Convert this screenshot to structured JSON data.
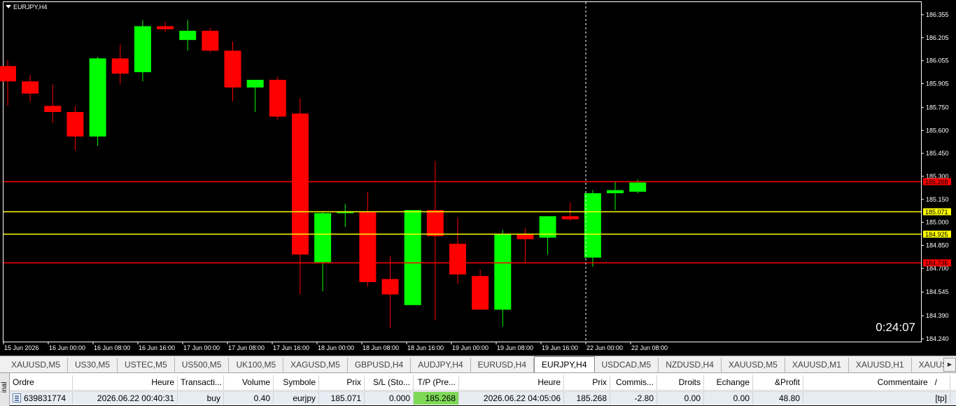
{
  "chart": {
    "title": "EURJPY,H4",
    "timer": "0:24:07",
    "price_labels": [
      "186.355",
      "186.205",
      "186.055",
      "185.905",
      "185.750",
      "185.600",
      "185.450",
      "185.300",
      "185.150",
      "185.000",
      "184.850",
      "184.700",
      "184.545",
      "184.390",
      "184.240"
    ],
    "time_labels": [
      "15 Jun 2026",
      "16 Jun 00:00",
      "16 Jun 08:00",
      "16 Jun 16:00",
      "17 Jun 00:00",
      "17 Jun 08:00",
      "17 Jun 16:00",
      "18 Jun 00:00",
      "18 Jun 08:00",
      "18 Jun 16:00",
      "19 Jun 00:00",
      "19 Jun 08:00",
      "19 Jun 16:00",
      "22 Jun 00:00",
      "22 Jun 08:00"
    ],
    "lines": [
      {
        "price": 185.268,
        "label": "185.268",
        "color": "#ff0000",
        "label_bg": "#ff0000"
      },
      {
        "price": 185.071,
        "label": "185.071",
        "color": "#ffff00",
        "label_bg": "#ffff00"
      },
      {
        "price": 184.925,
        "label": "184.925",
        "color": "#ffff00",
        "label_bg": "#ffff00"
      },
      {
        "price": 184.736,
        "label": "184.736",
        "color": "#ff0000",
        "label_bg": "#ff0000"
      }
    ],
    "colors": {
      "bull": "#00ff00",
      "bear": "#ff0000",
      "background": "#000000",
      "axis": "#ffffff"
    }
  },
  "chart_data": {
    "type": "candlestick",
    "symbol": "EURJPY",
    "timeframe": "H4",
    "ylim": [
      184.24,
      186.42
    ],
    "candles": [
      {
        "o": 186.02,
        "h": 186.06,
        "l": 185.76,
        "c": 185.92
      },
      {
        "o": 185.92,
        "h": 185.96,
        "l": 185.79,
        "c": 185.84
      },
      {
        "o": 185.76,
        "h": 185.9,
        "l": 185.65,
        "c": 185.72
      },
      {
        "o": 185.72,
        "h": 185.76,
        "l": 185.47,
        "c": 185.56
      },
      {
        "o": 185.56,
        "h": 186.08,
        "l": 185.5,
        "c": 186.07
      },
      {
        "o": 186.07,
        "h": 186.16,
        "l": 185.9,
        "c": 185.97
      },
      {
        "o": 185.98,
        "h": 186.32,
        "l": 185.92,
        "c": 186.28
      },
      {
        "o": 186.28,
        "h": 186.31,
        "l": 186.24,
        "c": 186.26
      },
      {
        "o": 186.19,
        "h": 186.32,
        "l": 186.12,
        "c": 186.25
      },
      {
        "o": 186.25,
        "h": 186.27,
        "l": 186.11,
        "c": 186.12
      },
      {
        "o": 186.12,
        "h": 186.18,
        "l": 185.79,
        "c": 185.88
      },
      {
        "o": 185.88,
        "h": 185.93,
        "l": 185.72,
        "c": 185.93
      },
      {
        "o": 185.93,
        "h": 185.95,
        "l": 185.67,
        "c": 185.69
      },
      {
        "o": 185.71,
        "h": 185.81,
        "l": 184.53,
        "c": 184.79
      },
      {
        "o": 184.74,
        "h": 185.07,
        "l": 184.55,
        "c": 185.06
      },
      {
        "o": 185.06,
        "h": 185.12,
        "l": 184.97,
        "c": 185.07
      },
      {
        "o": 185.07,
        "h": 185.2,
        "l": 184.58,
        "c": 184.61
      },
      {
        "o": 184.63,
        "h": 184.78,
        "l": 184.31,
        "c": 184.53
      },
      {
        "o": 184.46,
        "h": 185.08,
        "l": 184.46,
        "c": 185.08
      },
      {
        "o": 185.08,
        "h": 185.4,
        "l": 184.36,
        "c": 184.91
      },
      {
        "o": 184.86,
        "h": 185.03,
        "l": 184.6,
        "c": 184.66
      },
      {
        "o": 184.65,
        "h": 184.69,
        "l": 184.43,
        "c": 184.43
      },
      {
        "o": 184.43,
        "h": 184.95,
        "l": 184.32,
        "c": 184.92
      },
      {
        "o": 184.92,
        "h": 184.96,
        "l": 184.74,
        "c": 184.89
      },
      {
        "o": 184.9,
        "h": 185.03,
        "l": 184.79,
        "c": 185.04
      },
      {
        "o": 185.04,
        "h": 185.13,
        "l": 185.01,
        "c": 185.02
      },
      {
        "o": 184.77,
        "h": 185.21,
        "l": 184.71,
        "c": 185.19
      },
      {
        "o": 185.19,
        "h": 185.27,
        "l": 185.08,
        "c": 185.21
      },
      {
        "o": 185.2,
        "h": 185.28,
        "l": 185.19,
        "c": 185.26
      }
    ]
  },
  "tabs": [
    "XAUUSD,M5",
    "US30,M5",
    "USTEC,M5",
    "US500,M5",
    "UK100,M5",
    "XAGUSD,M5",
    "GBPUSD,H4",
    "AUDJPY,H4",
    "EURUSD,H4",
    "EURJPY,H4",
    "USDCAD,M5",
    "NZDUSD,H4",
    "XAUUSD,M5",
    "XAUUSD,M1",
    "XAUUSD,H1",
    "XAUUSD,Wee"
  ],
  "active_tab": "EURJPY,H4",
  "terminal": {
    "side_label": "inal",
    "headers": [
      "Ordre",
      "Heure",
      "Transacti...",
      "Volume",
      "Symbole",
      "Prix",
      "S/L (Sto...",
      "T/P (Pre...",
      "Heure",
      "Prix",
      "Commis...",
      "Droits",
      "Echange",
      "&Profit",
      "Commentaire"
    ],
    "row": [
      "639831774",
      "2026.06.22 00:40:31",
      "buy",
      "0.40",
      "eurjpy",
      "185.071",
      "0.000",
      "185.268",
      "2026.06.22 04:05:06",
      "185.268",
      "-2.80",
      "0.00",
      "0.00",
      "48.80",
      "[tp]"
    ],
    "sort_indicator": "/"
  }
}
